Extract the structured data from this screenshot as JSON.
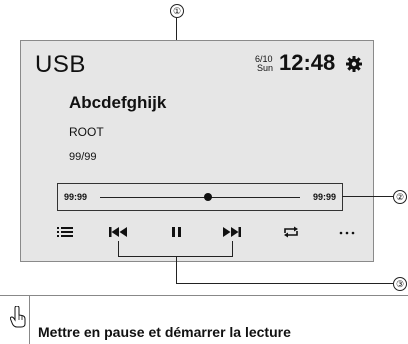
{
  "screen": {
    "source_label": "USB",
    "date_month": "6/10",
    "date_day": "Sun",
    "clock": "12:48",
    "track_title": "Abcdefghijk",
    "folder": "ROOT",
    "track_count": "99/99",
    "elapsed_time": "99:99",
    "total_time": "99:99",
    "playback_progress": 0.5
  },
  "icons": {
    "settings": "gear-icon",
    "list": "list-icon",
    "prev": "skip-previous-icon",
    "pause": "pause-icon",
    "next": "skip-next-icon",
    "repeat": "repeat-icon",
    "more": "more-icon",
    "note": "hand-pointer-icon"
  },
  "callouts": [
    "①",
    "②",
    "③"
  ],
  "note": "Mettre en pause et démarrer la lecture"
}
